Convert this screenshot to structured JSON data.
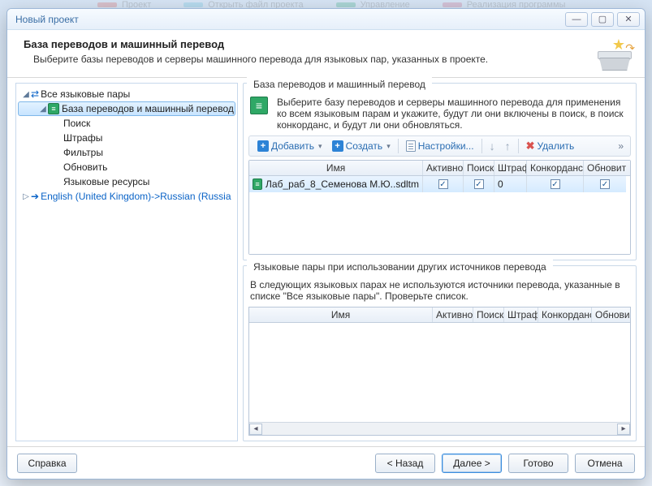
{
  "window": {
    "title": "Новый проект",
    "min": "—",
    "max": "▢",
    "close": "✕"
  },
  "bg_tabs": [
    {
      "label": "Проект",
      "color": "#d9534f"
    },
    {
      "label": "Открыть файл проекта",
      "color": "#5bc0de"
    },
    {
      "label": "Управление",
      "color": "#28a778"
    },
    {
      "label": "Реализация программы",
      "color": "#c95c7e"
    }
  ],
  "header": {
    "title": "База переводов и машинный перевод",
    "subtitle": "Выберите базы переводов и серверы машинного перевода для языковых пар, указанных в проекте."
  },
  "tree": {
    "root_label": "Все языковые пары",
    "node_tm": "База переводов и машинный перевод",
    "children": [
      "Поиск",
      "Штрафы",
      "Фильтры",
      "Обновить",
      "Языковые ресурсы"
    ],
    "pair_label": "English (United Kingdom)->Russian (Russia"
  },
  "group_top": {
    "title": "База переводов и машинный перевод",
    "hint": "Выберите базу переводов и серверы машинного перевода для применения ко всем языковым парам и укажите, будут ли они включены в поиск, в поиск конкорданс, и будут ли они обновляться."
  },
  "toolbar": {
    "add": "Добавить",
    "create": "Создать",
    "settings": "Настройки...",
    "delete": "Удалить"
  },
  "grid1": {
    "cols": {
      "name": "Имя",
      "active": "Активно",
      "search": "Поиск",
      "penalty": "Штраф",
      "concord": "Конкорданс",
      "update": "Обновить"
    },
    "rows": [
      {
        "name": "Лаб_раб_8_Семенова М.Ю..sdltm",
        "active": true,
        "search": true,
        "penalty": "0",
        "concord": true,
        "update": true
      }
    ]
  },
  "group_low": {
    "title": "Языковые пары при использовании других источников перевода",
    "desc": "В следующих языковых парах не используются источники перевода, указанные в списке \"Все языковые пары\". Проверьте список.",
    "cols": {
      "name": "Имя",
      "active": "Активно",
      "search": "Поиск",
      "penalty": "Штраф",
      "concord": "Конкорданс",
      "update": "Обнови"
    }
  },
  "footer": {
    "help": "Справка",
    "back": "< Назад",
    "next": "Далее >",
    "finish": "Готово",
    "cancel": "Отмена"
  }
}
